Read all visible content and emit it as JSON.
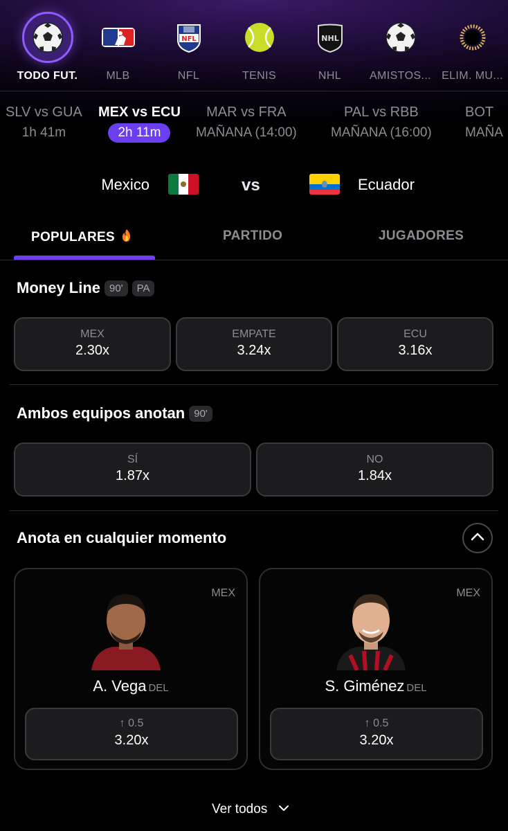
{
  "sports": [
    {
      "label": "TODO FUT.",
      "icon": "soccer-ball-icon",
      "active": true
    },
    {
      "label": "MLB",
      "icon": "mlb-logo-icon"
    },
    {
      "label": "NFL",
      "icon": "nfl-logo-icon"
    },
    {
      "label": "TENIS",
      "icon": "tennis-ball-icon"
    },
    {
      "label": "NHL",
      "icon": "nhl-logo-icon"
    },
    {
      "label": "AMISTOS...",
      "icon": "soccer-ball-icon"
    },
    {
      "label": "ELIM. MU...",
      "icon": "sun-ring-icon"
    }
  ],
  "matches": [
    {
      "teams": "SLV vs GUA",
      "time": "1h 41m"
    },
    {
      "teams": "MEX vs ECU",
      "time": "2h 11m",
      "active": true
    },
    {
      "teams": "MAR vs FRA",
      "time": "MAÑANA (14:00)"
    },
    {
      "teams": "PAL vs RBB",
      "time": "MAÑANA (16:00)"
    },
    {
      "teams": "BOT",
      "time": "MAÑA"
    }
  ],
  "game": {
    "home": "Mexico",
    "vs": "vs",
    "away": "Ecuador"
  },
  "tabs": [
    {
      "label": "POPULARES",
      "icon": "fire-icon",
      "active": true
    },
    {
      "label": "PARTIDO"
    },
    {
      "label": "JUGADORES"
    }
  ],
  "money_line": {
    "title": "Money Line",
    "tags": [
      "90'",
      "PA"
    ],
    "options": [
      {
        "label": "MEX",
        "odds": "2.30x"
      },
      {
        "label": "EMPATE",
        "odds": "3.24x"
      },
      {
        "label": "ECU",
        "odds": "3.16x"
      }
    ]
  },
  "btts": {
    "title": "Ambos equipos anotan",
    "tag": "90'",
    "options": [
      {
        "label": "SÍ",
        "odds": "1.87x"
      },
      {
        "label": "NO",
        "odds": "1.84x"
      }
    ]
  },
  "anytime": {
    "title": "Anota en cualquier momento",
    "players": [
      {
        "team": "MEX",
        "name": "A. Vega",
        "pos": "DEL",
        "line": "↑ 0.5",
        "odds": "3.20x"
      },
      {
        "team": "MEX",
        "name": "S. Giménez",
        "pos": "DEL",
        "line": "↑ 0.5",
        "odds": "3.20x"
      }
    ],
    "see_all": "Ver todos"
  },
  "colors": {
    "accent": "#6b3ff0",
    "accent_ring": "#8f5cff",
    "card_bg": "#1c1c1e",
    "border": "#3a3a3e",
    "muted": "#8c8c92"
  }
}
